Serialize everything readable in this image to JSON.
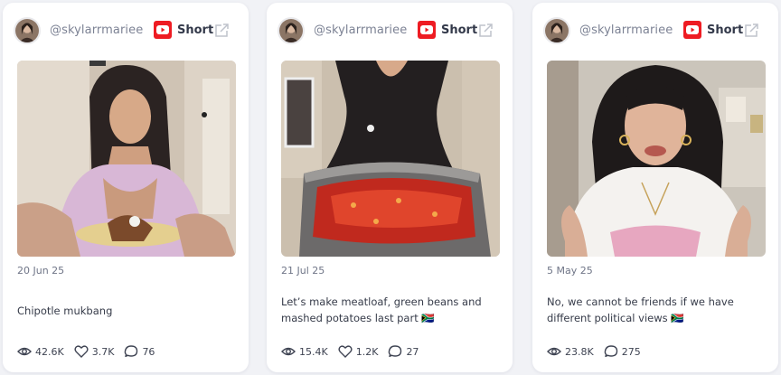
{
  "cards": [
    {
      "username": "@skylarrmariee",
      "type_label": "Short",
      "date": "20 Jun 25",
      "caption": "Chipotle mukbang",
      "views": "42.6K",
      "likes": "3.7K",
      "comments": "76"
    },
    {
      "username": "@skylarrmariee",
      "type_label": "Short",
      "date": "21 Jul 25",
      "caption": "Let’s make meatloaf, green beans and mashed potatoes last part 🇿🇦",
      "views": "15.4K",
      "likes": "1.2K",
      "comments": "27"
    },
    {
      "username": "@skylarrmariee",
      "type_label": "Short",
      "date": "5 May 25",
      "caption": "No, we cannot be friends if we have different political views 🇿🇦",
      "views": "23.8K",
      "comments": "275"
    }
  ],
  "colors": {
    "youtube_red": "#ee1c23",
    "card_bg": "#ffffff",
    "page_bg": "#f1f2f6"
  },
  "icons": {
    "platform": "youtube-icon",
    "external": "external-link-icon",
    "views": "eye-icon",
    "likes": "heart-icon",
    "comments": "comment-icon"
  }
}
